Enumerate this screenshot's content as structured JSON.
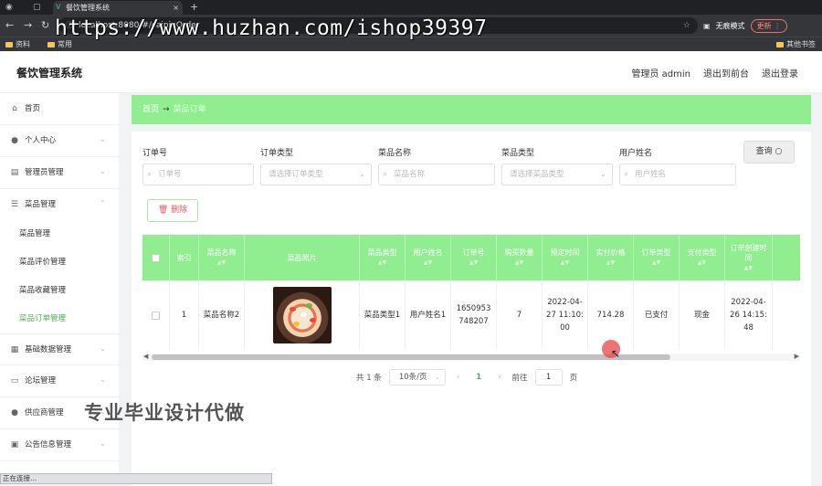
{
  "browser": {
    "tab_title": "餐饮管理系统",
    "url": "localhost:8080/#/caipinOrder",
    "incognito_label": "无痕模式",
    "update_label": "更新",
    "bookmarks": [
      "资料",
      "常用"
    ],
    "bookmarks_right": "其他书签",
    "watermark": "https://www.huzhan.com/ishop39397"
  },
  "header": {
    "title": "餐饮管理系统",
    "links": [
      "管理员 admin",
      "退出到前台",
      "退出登录"
    ]
  },
  "sidebar": {
    "items": [
      {
        "label": "首页",
        "icon": "home-icon"
      },
      {
        "label": "个人中心",
        "icon": "user-icon"
      },
      {
        "label": "管理员管理",
        "icon": "admin-icon"
      },
      {
        "label": "菜品管理",
        "icon": "sliders-icon"
      },
      {
        "label": "基础数据管理",
        "icon": "data-icon"
      },
      {
        "label": "论坛管理",
        "icon": "forum-icon"
      },
      {
        "label": "供应商管理",
        "icon": "supplier-icon"
      },
      {
        "label": "公告信息管理",
        "icon": "notice-icon"
      }
    ],
    "sub_items": [
      "菜品管理",
      "菜品评价管理",
      "菜品收藏管理",
      "菜品订单管理"
    ]
  },
  "breadcrumb": {
    "home": "首页",
    "current": "菜品订单"
  },
  "filters": {
    "order_no": {
      "label": "订单号",
      "placeholder": "订单号"
    },
    "order_type": {
      "label": "订单类型",
      "placeholder": "请选择订单类型"
    },
    "dish_name": {
      "label": "菜品名称",
      "placeholder": "菜品名称"
    },
    "dish_type": {
      "label": "菜品类型",
      "placeholder": "请选择菜品类型"
    },
    "user_name": {
      "label": "用户姓名",
      "placeholder": "用户姓名"
    },
    "query_label": "查询",
    "delete_label": "删除"
  },
  "table": {
    "headers": [
      "索引",
      "菜品名称",
      "菜品照片",
      "菜品类型",
      "用户姓名",
      "订单号",
      "购买数量",
      "预定时间",
      "实付价格",
      "订单类型",
      "支付类型",
      "订单创建时间"
    ],
    "rows": [
      {
        "index": "1",
        "dish_name": "菜品名称2",
        "dish_type": "菜品类型1",
        "user_name": "用户姓名1",
        "order_no": "1650953748207",
        "quantity": "7",
        "reserve_time": "2022-04-27 11:10:00",
        "price": "714.28",
        "order_type": "已支付",
        "pay_type": "现金",
        "created": "2022-04-26 14:15:48"
      }
    ]
  },
  "pager": {
    "total": "共 1 条",
    "page_size": "10条/页",
    "current": "1",
    "goto_label": "前往",
    "goto_value": "1",
    "page_suffix": "页"
  },
  "promo_text": "专业毕业设计代做",
  "status_text": "正在连接..."
}
